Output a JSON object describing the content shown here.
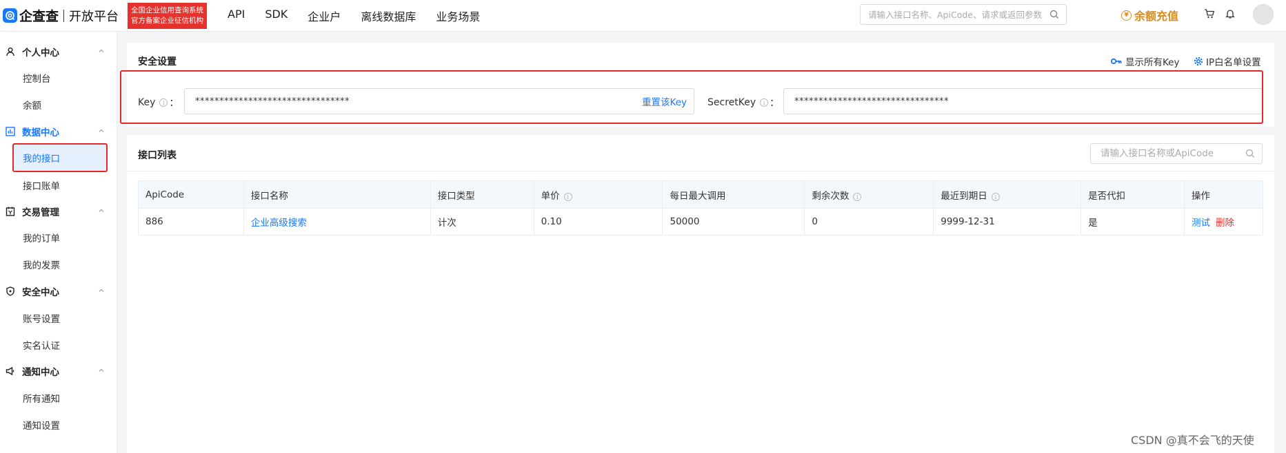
{
  "brand": {
    "logo_text": "企查查",
    "sub_title": "开放平台",
    "badge_line1": "全国企业信用查询系统",
    "badge_line2": "官方备案企业征信机构"
  },
  "top_nav": [
    "API",
    "SDK",
    "企业户",
    "离线数据库",
    "业务场景"
  ],
  "top_search": {
    "placeholder": "请输入接口名称、ApiCode、请求或返回参数"
  },
  "recharge": {
    "coin": "¥",
    "label": "余额充值"
  },
  "sidebar": {
    "groups": [
      {
        "label": "个人中心",
        "icon": "user-icon",
        "items": [
          "控制台",
          "余额"
        ]
      },
      {
        "label": "数据中心",
        "icon": "chart-icon",
        "items": [
          "我的接口",
          "接口账单"
        ]
      },
      {
        "label": "交易管理",
        "icon": "transaction-icon",
        "items": [
          "我的订单",
          "我的发票"
        ]
      },
      {
        "label": "安全中心",
        "icon": "shield-icon",
        "items": [
          "账号设置",
          "实名认证"
        ]
      },
      {
        "label": "通知中心",
        "icon": "megaphone-icon",
        "items": [
          "所有通知",
          "通知设置"
        ]
      }
    ],
    "active_item": "我的接口"
  },
  "security": {
    "title": "安全设置",
    "show_all_keys": "显示所有Key",
    "ip_whitelist": "IP白名单设置",
    "key_label": "Key",
    "key_value": "********************************",
    "reset_key": "重置该Key",
    "secret_label": "SecretKey",
    "secret_value": "********************************",
    "colon": "："
  },
  "api_list": {
    "title": "接口列表",
    "search_placeholder": "请输入接口名称或ApiCode",
    "columns": [
      "ApiCode",
      "接口名称",
      "接口类型",
      "单价",
      "每日最大调用",
      "剩余次数",
      "最近到期日",
      "是否代扣",
      "操作"
    ],
    "rows": [
      {
        "api_code": "886",
        "name": "企业高级搜索",
        "type": "计次",
        "price": "0.10",
        "daily_max": "50000",
        "remaining": "0",
        "expiry": "9999-12-31",
        "auto_deduct": "是",
        "action_test": "测试",
        "action_delete": "删除"
      }
    ]
  },
  "watermark": "CSDN @真不会飞的天使",
  "colors": {
    "accent": "#1677ff",
    "danger": "#e5322d",
    "gold": "#d98c1a",
    "highlight": "#e42727"
  }
}
